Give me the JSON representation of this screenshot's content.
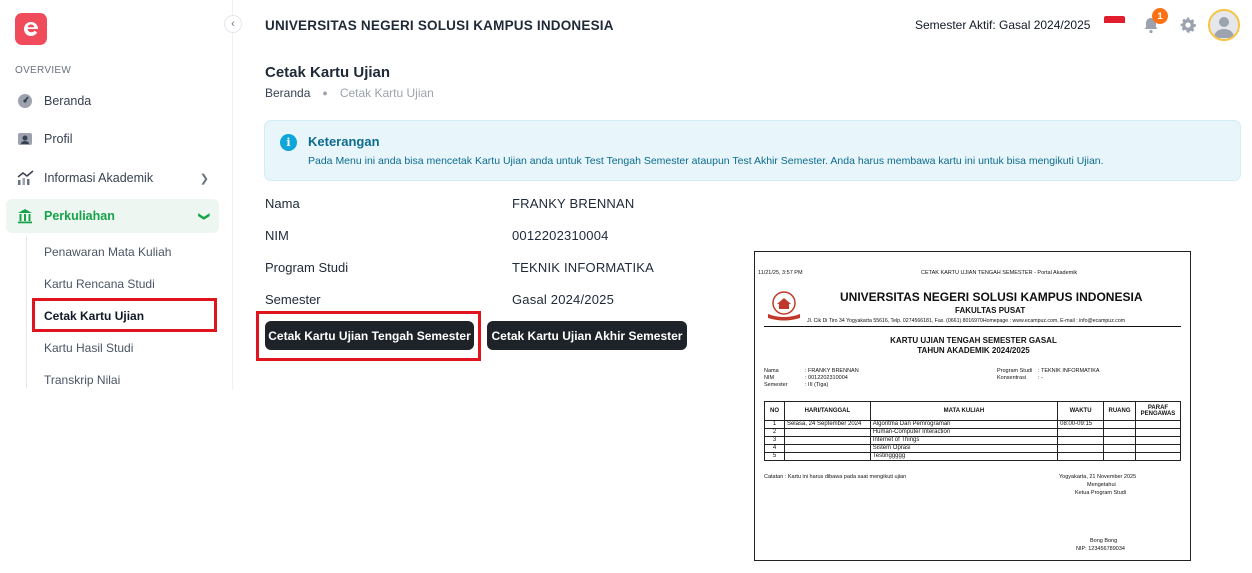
{
  "sidebar": {
    "section_label": "OVERVIEW",
    "items": [
      {
        "label": "Beranda",
        "icon": "dashboard-gauge-icon"
      },
      {
        "label": "Profil",
        "icon": "profile-card-icon"
      },
      {
        "label": "Informasi Akademik",
        "icon": "chart-icon"
      },
      {
        "label": "Perkuliahan",
        "icon": "university-building-icon"
      }
    ],
    "sub_items": [
      "Penawaran Mata Kuliah",
      "Kartu Rencana Studi",
      "Cetak Kartu Ujian",
      "Kartu Hasil Studi",
      "Transkrip Nilai"
    ]
  },
  "header": {
    "title": "UNIVERSITAS NEGERI SOLUSI KAMPUS INDONESIA",
    "semester": "Semester Aktif: Gasal 2024/2025",
    "notification_count": "1"
  },
  "page": {
    "title": "Cetak Kartu Ujian",
    "breadcrumb": {
      "home": "Beranda",
      "current": "Cetak Kartu Ujian"
    }
  },
  "alert": {
    "title": "Keterangan",
    "message": "Pada Menu ini anda bisa mencetak Kartu Ujian anda untuk Test Tengah Semester ataupun Test Akhir Semester. Anda harus membawa kartu ini untuk bisa mengikuti Ujian."
  },
  "student": {
    "name_label": "Nama",
    "name": "FRANKY BRENNAN",
    "nim_label": "NIM",
    "nim": "0012202310004",
    "prodi_label": "Program Studi",
    "prodi": "TEKNIK INFORMATIKA",
    "semester_label": "Semester",
    "semester": "Gasal 2024/2025"
  },
  "buttons": {
    "uts": "Cetak Kartu Ujian Tengah Semester",
    "uas": "Cetak Kartu Ujian Akhir Semester"
  },
  "preview": {
    "timestamp": "11/21/25, 3:57 PM",
    "page_title": "CETAK KARTU UJIAN TENGAH SEMESTER - Portal Akademik",
    "university": "UNIVERSITAS NEGERI SOLUSI KAMPUS INDONESIA",
    "faculty": "FAKULTAS PUSAT",
    "address": "Jl. Cik Di Tiro 34 Yogyakarta 55616, Telp. 0274566181, Fax. (0661) 8016970Homepage : www.ecampuz.com, E-mail : info@ecampuz.com",
    "heading1": "KARTU UJIAN TENGAH SEMESTER GASAL",
    "heading2": "TAHUN AKADEMIK 2024/2025",
    "nama_label": "Nama",
    "nama_value": ": FRANKY BRENNAN",
    "nim_label": "NIM",
    "nim_value": ": 0012202310004",
    "sem_label": "Semester",
    "sem_value": ": III (Tiga)",
    "prodi_label": "Program Studi",
    "prodi_value": ": TEKNIK INFORMATIKA",
    "konsentrasi_label": "Konsentrasi",
    "konsentrasi_value": ": -",
    "table_headers": [
      "NO",
      "HARI/TANGGAL",
      "MATA KULIAH",
      "WAKTU",
      "RUANG",
      "PARAF PENGAWAS"
    ],
    "rows": [
      [
        "1",
        "Selasa, 24 September 2024",
        "Algoritma Dan Pemrograman",
        "08:00-09:15",
        "",
        ""
      ],
      [
        "2",
        "",
        "Human-Computer Interaction",
        "",
        "",
        ""
      ],
      [
        "3",
        "",
        "Internet of Things",
        "",
        "",
        ""
      ],
      [
        "4",
        "",
        "Sistem Oprasi",
        "",
        "",
        ""
      ],
      [
        "5",
        "",
        "Testinggggg",
        "",
        "",
        ""
      ]
    ],
    "catatan": "Catatan : Kartu ini harus dibawa pada saat mengikuti ujian",
    "place_date": "Yogyakarta, 21 November 2025",
    "mengetahui": "Mengetahui",
    "ketua": "Ketua Program Studi",
    "signer": "Bong Bong",
    "nip": "NIP: 123456789034"
  },
  "colors": {
    "brand": "#ef4b5a",
    "active_green": "#16a34a",
    "highlight_red": "#e0141e",
    "button_dark": "#1e2329",
    "info_blue": "#0ea5d8"
  }
}
